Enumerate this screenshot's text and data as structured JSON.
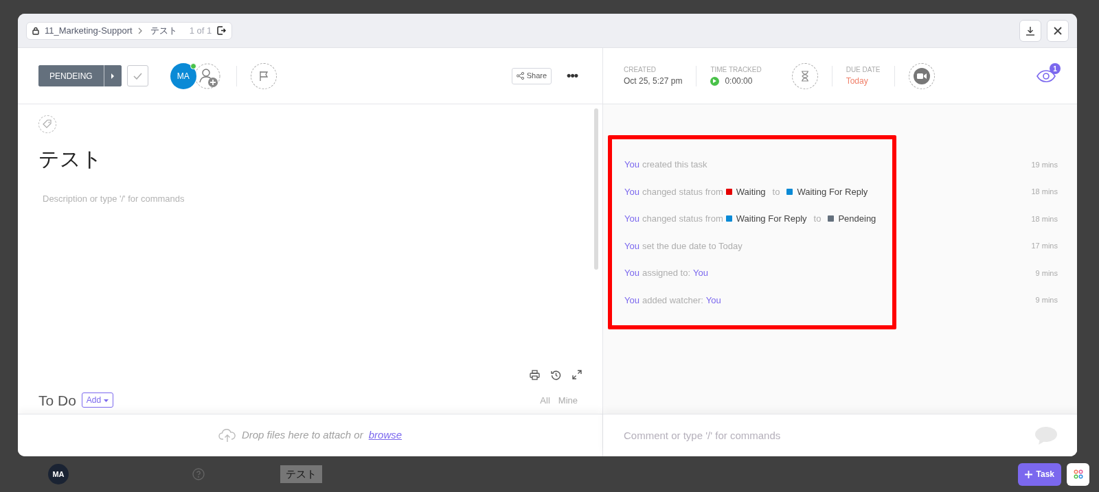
{
  "breadcrumb": {
    "list": "11_Marketing-Support",
    "task": "テスト",
    "counter": "1 of 1"
  },
  "status_button": {
    "label": "PENDEING",
    "color": "#64707d"
  },
  "complete": {
    "checked": false
  },
  "assignee": {
    "initials": "MA",
    "online": true
  },
  "share": "Share",
  "more": "•••",
  "task": {
    "title": "テスト",
    "placeholder": "Description or type '/' for commands"
  },
  "todo": {
    "title": "To Do",
    "add": "Add",
    "filters": [
      "All",
      "Mine"
    ]
  },
  "attach": {
    "text": "Drop files here to attach or",
    "link": "browse"
  },
  "meta": {
    "created_label": "CREATED",
    "created": "Oct 25, 5:27 pm",
    "tracked_label": "TIME TRACKED",
    "tracked": "0:00:00",
    "due_label": "DUE DATE",
    "due": "Today"
  },
  "watchers": {
    "count": "1"
  },
  "activity": [
    {
      "parts": [
        {
          "kind": "actor",
          "text": "You"
        },
        {
          "kind": "text",
          "text": "created this task"
        }
      ],
      "time": "19 mins"
    },
    {
      "parts": [
        {
          "kind": "actor",
          "text": "You"
        },
        {
          "kind": "text",
          "text": "changed status from"
        },
        {
          "kind": "status",
          "text": "Waiting",
          "color": "#e50000"
        },
        {
          "kind": "text",
          "text": "to"
        },
        {
          "kind": "status",
          "text": "Waiting For Reply",
          "color": "#0a8ad6"
        }
      ],
      "time": "18 mins"
    },
    {
      "parts": [
        {
          "kind": "actor",
          "text": "You"
        },
        {
          "kind": "text",
          "text": "changed status from"
        },
        {
          "kind": "status",
          "text": "Waiting For Reply",
          "color": "#0a8ad6"
        },
        {
          "kind": "text",
          "text": "to"
        },
        {
          "kind": "status",
          "text": "Pendeing",
          "color": "#64707d"
        }
      ],
      "time": "18 mins"
    },
    {
      "parts": [
        {
          "kind": "actor",
          "text": "You"
        },
        {
          "kind": "text",
          "text": "set the due date to Today"
        }
      ],
      "time": "17 mins"
    },
    {
      "parts": [
        {
          "kind": "actor",
          "text": "You"
        },
        {
          "kind": "text",
          "text": "assigned to:"
        },
        {
          "kind": "actor",
          "text": "You"
        }
      ],
      "time": "9 mins"
    },
    {
      "parts": [
        {
          "kind": "actor",
          "text": "You"
        },
        {
          "kind": "text",
          "text": "added watcher:"
        },
        {
          "kind": "actor",
          "text": "You"
        }
      ],
      "time": "9 mins"
    }
  ],
  "comment": {
    "placeholder": "Comment or type '/' for commands"
  },
  "fab": {
    "label": "Task"
  },
  "background": {
    "task": "テスト",
    "logo": "MA"
  }
}
